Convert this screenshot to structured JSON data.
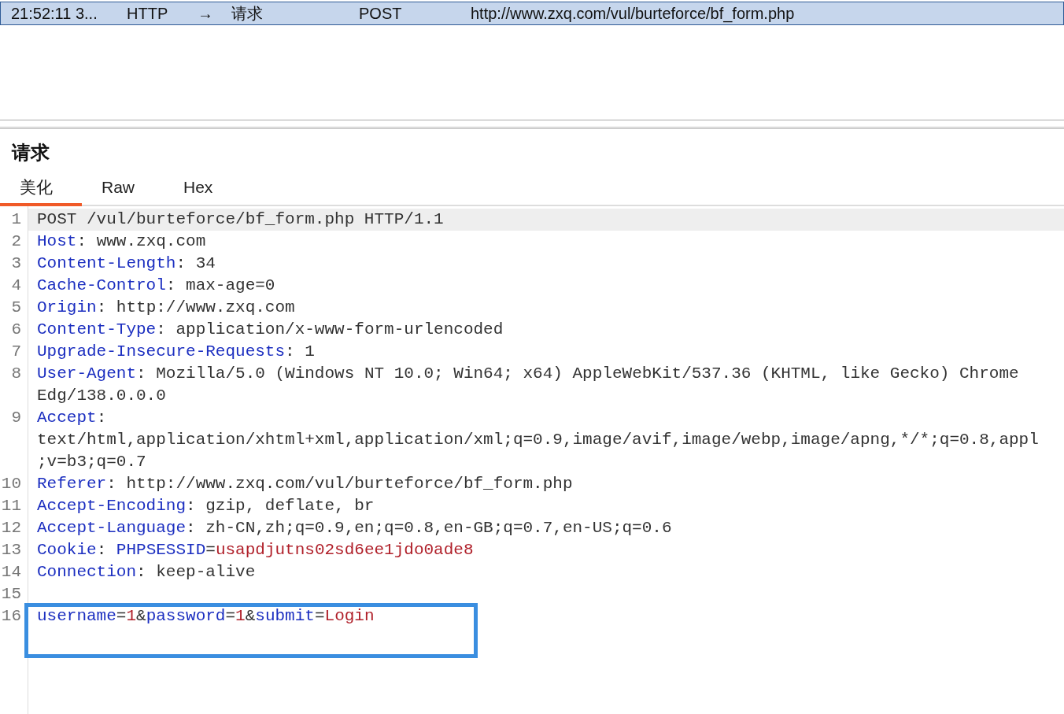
{
  "history_row": {
    "selected": true,
    "cells": [
      "21:52:11 3...",
      "HTTP",
      "→",
      "请求",
      "POST",
      "http://www.zxq.com/vul/burteforce/bf_form.php"
    ]
  },
  "request_panel": {
    "title": "请求",
    "tabs": [
      {
        "label": "美化",
        "selected": true
      },
      {
        "label": "Raw",
        "selected": false
      },
      {
        "label": "Hex",
        "selected": false
      }
    ],
    "lines": [
      {
        "number": "1",
        "current": true,
        "highlighted": false,
        "rows": [
          [
            {
              "kind": "plain",
              "text": "POST /vul/burteforce/bf_form.php HTTP/1.1"
            }
          ]
        ]
      },
      {
        "number": "2",
        "current": false,
        "highlighted": false,
        "rows": [
          [
            {
              "kind": "key",
              "text": "Host"
            },
            {
              "kind": "plain",
              "text": ": www.zxq.com"
            }
          ]
        ]
      },
      {
        "number": "3",
        "current": false,
        "highlighted": false,
        "rows": [
          [
            {
              "kind": "key",
              "text": "Content-Length"
            },
            {
              "kind": "plain",
              "text": ": 34"
            }
          ]
        ]
      },
      {
        "number": "4",
        "current": false,
        "highlighted": false,
        "rows": [
          [
            {
              "kind": "key",
              "text": "Cache-Control"
            },
            {
              "kind": "plain",
              "text": ": max-age=0"
            }
          ]
        ]
      },
      {
        "number": "5",
        "current": false,
        "highlighted": false,
        "rows": [
          [
            {
              "kind": "key",
              "text": "Origin"
            },
            {
              "kind": "plain",
              "text": ": http://www.zxq.com"
            }
          ]
        ]
      },
      {
        "number": "6",
        "current": false,
        "highlighted": false,
        "rows": [
          [
            {
              "kind": "key",
              "text": "Content-Type"
            },
            {
              "kind": "plain",
              "text": ": application/x-www-form-urlencoded"
            }
          ]
        ]
      },
      {
        "number": "7",
        "current": false,
        "highlighted": false,
        "rows": [
          [
            {
              "kind": "key",
              "text": "Upgrade-Insecure-Requests"
            },
            {
              "kind": "plain",
              "text": ": 1"
            }
          ]
        ]
      },
      {
        "number": "8",
        "current": false,
        "highlighted": false,
        "rows": [
          [
            {
              "kind": "key",
              "text": "User-Agent"
            },
            {
              "kind": "plain",
              "text": ": Mozilla/5.0 (Windows NT 10.0; Win64; x64) AppleWebKit/537.36 (KHTML, like Gecko) Chrome"
            }
          ],
          [
            {
              "kind": "plain",
              "text": "Edg/138.0.0.0"
            }
          ]
        ]
      },
      {
        "number": "9",
        "current": false,
        "highlighted": false,
        "rows": [
          [
            {
              "kind": "key",
              "text": "Accept"
            },
            {
              "kind": "plain",
              "text": ":"
            }
          ],
          [
            {
              "kind": "plain",
              "text": "text/html,application/xhtml+xml,application/xml;q=0.9,image/avif,image/webp,image/apng,*/*;q=0.8,appl"
            }
          ],
          [
            {
              "kind": "plain",
              "text": ";v=b3;q=0.7"
            }
          ]
        ]
      },
      {
        "number": "10",
        "current": false,
        "highlighted": false,
        "rows": [
          [
            {
              "kind": "key",
              "text": "Referer"
            },
            {
              "kind": "plain",
              "text": ": http://www.zxq.com/vul/burteforce/bf_form.php"
            }
          ]
        ]
      },
      {
        "number": "11",
        "current": false,
        "highlighted": false,
        "rows": [
          [
            {
              "kind": "key",
              "text": "Accept-Encoding"
            },
            {
              "kind": "plain",
              "text": ": gzip, deflate, br"
            }
          ]
        ]
      },
      {
        "number": "12",
        "current": false,
        "highlighted": false,
        "rows": [
          [
            {
              "kind": "key",
              "text": "Accept-Language"
            },
            {
              "kind": "plain",
              "text": ": zh-CN,zh;q=0.9,en;q=0.8,en-GB;q=0.7,en-US;q=0.6"
            }
          ]
        ]
      },
      {
        "number": "13",
        "current": false,
        "highlighted": false,
        "rows": [
          [
            {
              "kind": "key",
              "text": "Cookie"
            },
            {
              "kind": "plain",
              "text": ": "
            },
            {
              "kind": "key",
              "text": "PHPSESSID"
            },
            {
              "kind": "plain",
              "text": "="
            },
            {
              "kind": "value",
              "text": "usapdjutns02sd6ee1jdo0ade8"
            }
          ]
        ]
      },
      {
        "number": "14",
        "current": false,
        "highlighted": false,
        "rows": [
          [
            {
              "kind": "key",
              "text": "Connection"
            },
            {
              "kind": "plain",
              "text": ": keep-alive"
            }
          ]
        ]
      },
      {
        "number": "15",
        "current": false,
        "highlighted": false,
        "rows": [
          []
        ]
      },
      {
        "number": "16",
        "current": false,
        "highlighted": true,
        "rows": [
          [
            {
              "kind": "key",
              "text": "username"
            },
            {
              "kind": "plain",
              "text": "="
            },
            {
              "kind": "value",
              "text": "1"
            },
            {
              "kind": "plain",
              "text": "&"
            },
            {
              "kind": "key",
              "text": "password"
            },
            {
              "kind": "plain",
              "text": "="
            },
            {
              "kind": "value",
              "text": "1"
            },
            {
              "kind": "plain",
              "text": "&"
            },
            {
              "kind": "key",
              "text": "submit"
            },
            {
              "kind": "plain",
              "text": "="
            },
            {
              "kind": "value",
              "text": "Login"
            }
          ]
        ]
      }
    ]
  }
}
